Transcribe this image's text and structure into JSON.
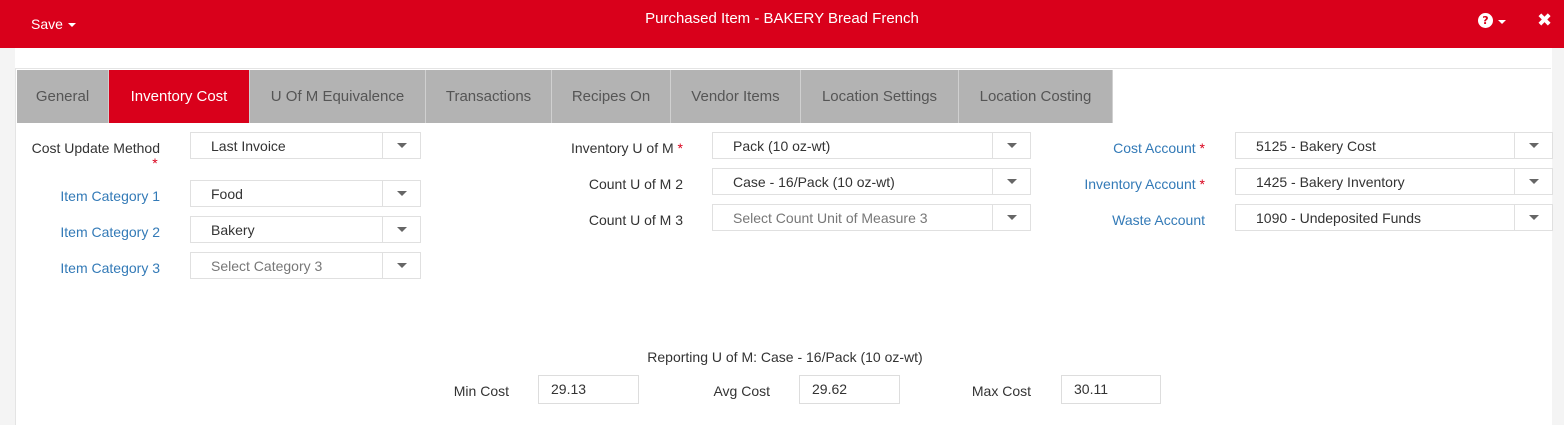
{
  "header": {
    "save_label": "Save",
    "title": "Purchased Item - BAKERY Bread French",
    "help_glyph": "?",
    "close_glyph": "✖"
  },
  "tabs": [
    {
      "label": "General",
      "active": false
    },
    {
      "label": "Inventory Cost",
      "active": true
    },
    {
      "label": "U Of M Equivalence",
      "active": false
    },
    {
      "label": "Transactions",
      "active": false
    },
    {
      "label": "Recipes On",
      "active": false
    },
    {
      "label": "Vendor Items",
      "active": false
    },
    {
      "label": "Location Settings",
      "active": false
    },
    {
      "label": "Location Costing",
      "active": false
    }
  ],
  "left": {
    "cost_update_method_label": "Cost Update Method",
    "cost_update_method_value": "Last Invoice",
    "item_category_1_label": "Item Category 1",
    "item_category_1_value": "Food",
    "item_category_2_label": "Item Category 2",
    "item_category_2_value": "Bakery",
    "item_category_3_label": "Item Category 3",
    "item_category_3_placeholder": "Select Category 3"
  },
  "middle": {
    "inventory_uom_label": "Inventory U of M",
    "inventory_uom_value": "Pack (10 oz-wt)",
    "count_uom_2_label": "Count U of M 2",
    "count_uom_2_value": "Case - 16/Pack (10 oz-wt)",
    "count_uom_3_label": "Count U of M 3",
    "count_uom_3_placeholder": "Select Count Unit of Measure 3"
  },
  "right": {
    "cost_account_label": "Cost Account",
    "cost_account_value": "5125 - Bakery Cost",
    "inventory_account_label": "Inventory Account",
    "inventory_account_value": "1425 - Bakery Inventory",
    "waste_account_label": "Waste Account",
    "waste_account_value": "1090 - Undeposited Funds"
  },
  "costs": {
    "reporting_uom": "Reporting U of M: Case - 16/Pack (10 oz-wt)",
    "min_label": "Min Cost",
    "min_value": "29.13",
    "avg_label": "Avg Cost",
    "avg_value": "29.62",
    "max_label": "Max Cost",
    "max_value": "30.11"
  },
  "required_marker": "*",
  "colors": {
    "brand_red": "#d9001b",
    "link_blue": "#337ab7",
    "tab_gray": "#b3b3b3"
  }
}
